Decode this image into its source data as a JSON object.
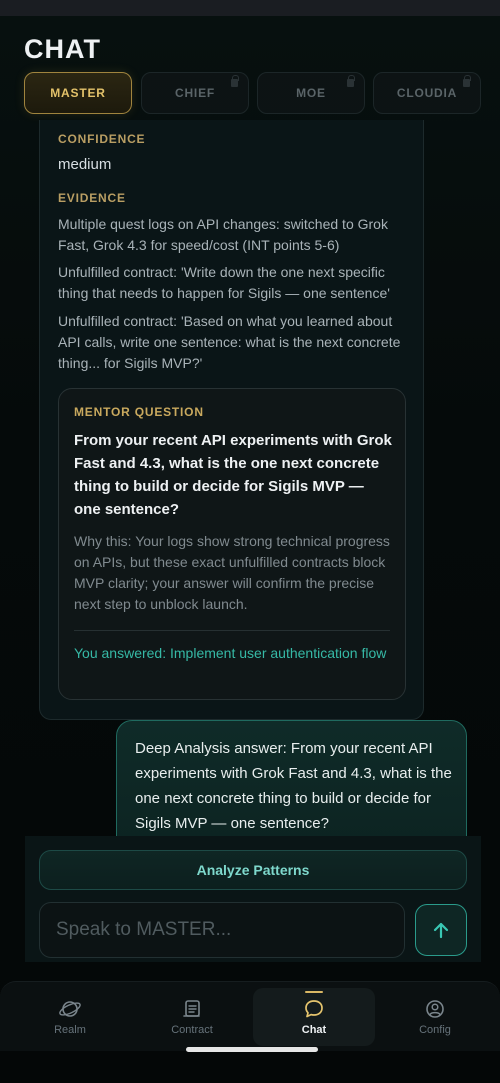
{
  "header": {
    "title": "CHAT"
  },
  "tabs": [
    {
      "label": "MASTER",
      "active": true
    },
    {
      "label": "CHIEF",
      "locked": true
    },
    {
      "label": "MOE",
      "locked": true
    },
    {
      "label": "CLOUDIA",
      "locked": true
    }
  ],
  "assistant": {
    "confidence_label": "CONFIDENCE",
    "confidence_value": "medium",
    "evidence_label": "EVIDENCE",
    "evidence": [
      "Multiple quest logs on API changes: switched to Grok Fast, Grok 4.3 for speed/cost (INT points 5-6)",
      "Unfulfilled contract: 'Write down the one next specific thing that needs to happen for Sigils — one sentence'",
      "Unfulfilled contract: 'Based on what you learned about API calls, write one sentence: what is the next concrete thing... for Sigils MVP?'"
    ],
    "mentor": {
      "label": "MENTOR QUESTION",
      "question": "From your recent API experiments with Grok Fast and 4.3, what is the one next concrete thing to build or decide for Sigils MVP — one sentence?",
      "why": "Why this: Your logs show strong technical progress on APIs, but these exact unfulfilled contracts block MVP clarity; your answer will confirm the precise next step to unblock launch.",
      "answer": "You answered: Implement user authentication flow"
    }
  },
  "user_message": {
    "text": "Deep Analysis answer: From your recent API experiments with Grok Fast and 4.3, what is the one next concrete thing to build or decide for Sigils MVP — one sentence?"
  },
  "composer": {
    "analyze_label": "Analyze Patterns",
    "placeholder": "Speak to MASTER...",
    "send_icon": "arrow-up-icon"
  },
  "nav": [
    {
      "label": "Realm",
      "icon": "planet-icon"
    },
    {
      "label": "Contract",
      "icon": "scroll-icon"
    },
    {
      "label": "Chat",
      "icon": "chat-bubble-icon",
      "active": true
    },
    {
      "label": "Config",
      "icon": "user-circle-icon"
    }
  ],
  "colors": {
    "accent_gold": "#d9b764",
    "accent_teal": "#36b9a6",
    "background": "#050a0a"
  }
}
